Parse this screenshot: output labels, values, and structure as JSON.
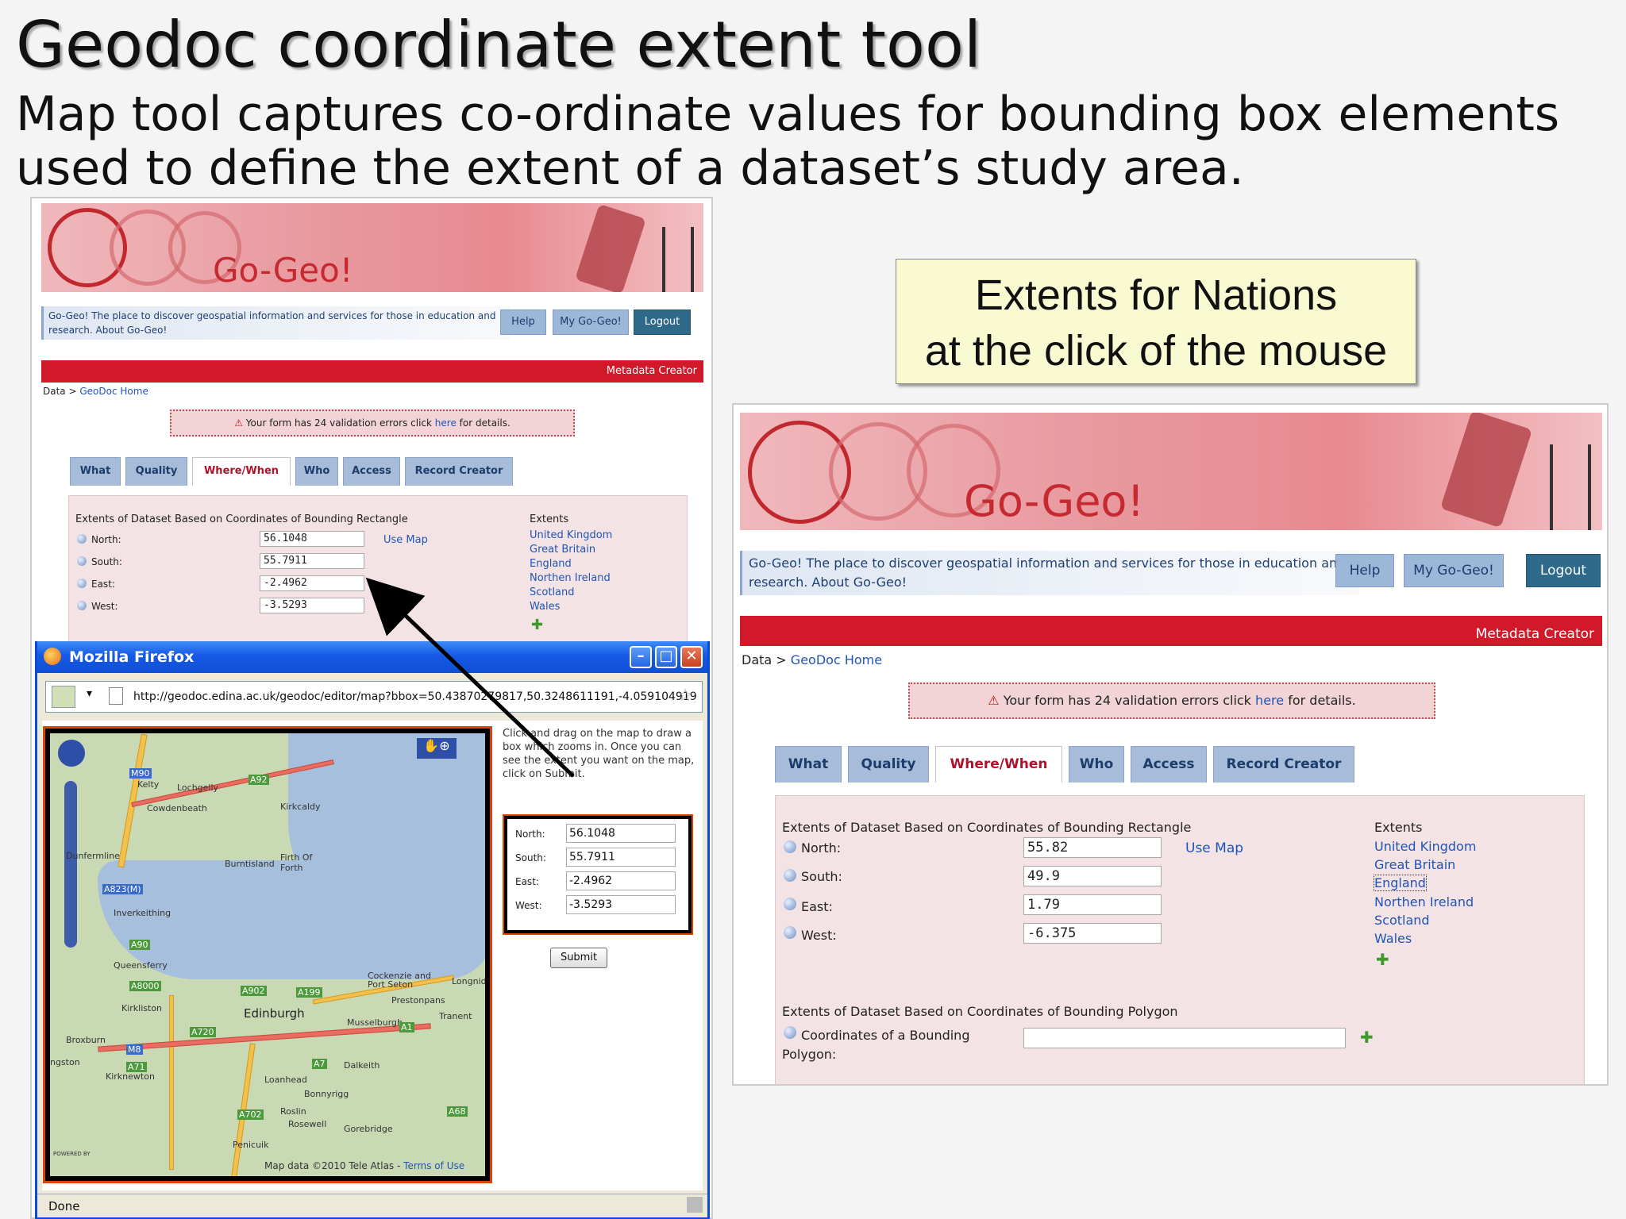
{
  "slide": {
    "title": "Geodoc coordinate extent tool",
    "subtitle": "Map tool captures co-ordinate values for bounding box elements used to define the extent of a dataset’s study area."
  },
  "callout": {
    "line1": "Extents for Nations",
    "line2": "at the click of the mouse"
  },
  "gogeo": {
    "brand": "Go-Geo!",
    "description": "Go-Geo! The place to discover geospatial information and services for those in education and research. About Go-Geo!",
    "nav": [
      "Help",
      "My Go-Geo!",
      "Logout"
    ],
    "section": "Metadata Creator",
    "breadcrumb_root": "Data",
    "breadcrumb_sep": ">",
    "breadcrumb_link": "GeoDoc Home",
    "validation_pre": "Your form has 24 validation errors click",
    "validation_link": "here",
    "validation_post": "for details.",
    "tabs": [
      "What",
      "Quality",
      "Where/When",
      "Who",
      "Access",
      "Record Creator"
    ],
    "active_tab": "Where/When",
    "rect_heading": "Extents of Dataset Based on Coordinates of Bounding Rectangle",
    "labels": {
      "north": "North:",
      "south": "South:",
      "east": "East:",
      "west": "West:"
    },
    "use_map": "Use Map",
    "extents_heading": "Extents",
    "extents": [
      "United Kingdom",
      "Great Britain",
      "England",
      "Northen Ireland",
      "Scotland",
      "Wales"
    ],
    "polygon_heading": "Extents of Dataset Based on Coordinates of Bounding Polygon",
    "polygon_label": "Coordinates of a Bounding Polygon:"
  },
  "left_values": {
    "north": "56.1048",
    "south": "55.7911",
    "east": "-2.4962",
    "west": "-3.5293"
  },
  "right_values": {
    "north": "55.82",
    "south": "49.9",
    "east": "1.79",
    "west": "-6.375"
  },
  "firefox": {
    "title": "Mozilla Firefox",
    "url": "http://geodoc.edina.ac.uk/geodoc/editor/map?bbox=50.43870279817,50.3248611191,-4.059104919",
    "instructions": "Click and drag on the map to draw a box which zooms in. Once you can see the extent you want on the map, click on Submit.",
    "popup_values": {
      "north": "56.1048",
      "south": "55.7911",
      "east": "-2.4962",
      "west": "-3.5293"
    },
    "submit": "Submit",
    "status": "Done",
    "map_attribution": "Map data ©2010 Tele Atlas -",
    "map_terms": "Terms of Use",
    "powered_by": "POWERED BY",
    "map_labels": [
      "Kelty",
      "Lochgelly",
      "Cowdenbeath",
      "Kirkcaldy",
      "Dunfermline",
      "Burntisland",
      "Firth Of Forth",
      "Inverkeithing",
      "Queensferry",
      "Kirkliston",
      "Edinburgh",
      "Broxburn",
      "Musselburgh",
      "Cockenzie and Port Seton",
      "Prestonpans",
      "Tranent",
      "Longniddry",
      "Dalkeith",
      "Loanhead",
      "Bonnyrigg",
      "Roslin",
      "Rosewell",
      "Gorebridge",
      "Penicuik",
      "Kirknewton",
      "ngston"
    ],
    "road_labels": [
      "M90",
      "A92",
      "A823(M)",
      "A90",
      "A8000",
      "A902",
      "A199",
      "A720",
      "M8",
      "A1",
      "A71",
      "A702",
      "A68",
      "A7"
    ]
  },
  "colors": {
    "brand_red": "#d1192a",
    "nav_blue": "#9db7d9",
    "link_blue": "#1f55b6",
    "callout_bg": "#fafad2"
  }
}
